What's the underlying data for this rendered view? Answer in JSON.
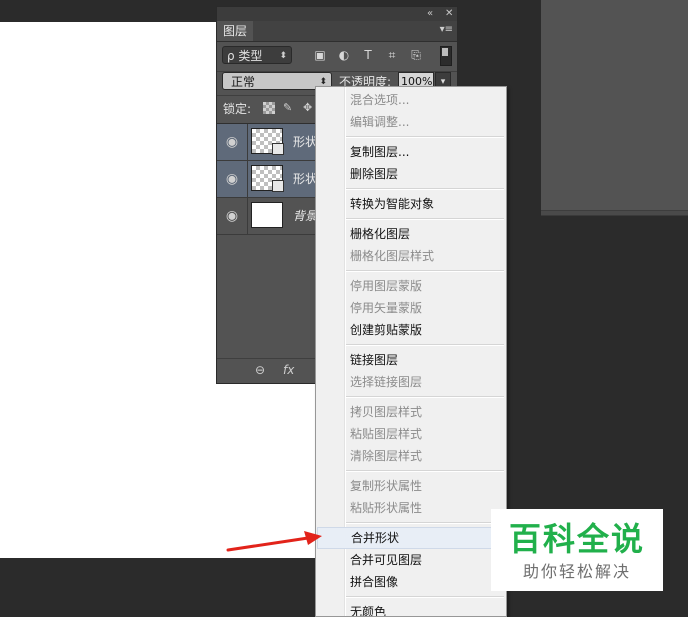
{
  "layers_panel": {
    "top_icons": {
      "collapse": "«",
      "close": "✕"
    },
    "tab_label": "图层",
    "filter": {
      "label": "ρ 类型"
    },
    "blend_mode": "正常",
    "opacity_label": "不透明度:",
    "opacity_value": "100%",
    "lock_label": "锁定:",
    "layers": [
      {
        "name": "形状",
        "thumbnail": "checker",
        "selected": true
      },
      {
        "name": "形状",
        "thumbnail": "checker",
        "selected": true
      },
      {
        "name": "背景",
        "thumbnail": "white",
        "selected": false
      }
    ],
    "footer_icons": {
      "link": "⊖",
      "fx": "fx"
    }
  },
  "context_menu": {
    "items": [
      {
        "label": "混合选项...",
        "disabled": true
      },
      {
        "label": "编辑调整...",
        "disabled": true
      },
      {
        "label": "复制图层...",
        "disabled": false
      },
      {
        "label": "删除图层",
        "disabled": false
      },
      {
        "label": "转换为智能对象",
        "disabled": false
      },
      {
        "label": "栅格化图层",
        "disabled": false
      },
      {
        "label": "栅格化图层样式",
        "disabled": true
      },
      {
        "label": "停用图层蒙版",
        "disabled": true
      },
      {
        "label": "停用矢量蒙版",
        "disabled": true
      },
      {
        "label": "创建剪贴蒙版",
        "disabled": false
      },
      {
        "label": "链接图层",
        "disabled": false
      },
      {
        "label": "选择链接图层",
        "disabled": true
      },
      {
        "label": "拷贝图层样式",
        "disabled": true
      },
      {
        "label": "粘贴图层样式",
        "disabled": true
      },
      {
        "label": "清除图层样式",
        "disabled": true
      },
      {
        "label": "复制形状属性",
        "disabled": true
      },
      {
        "label": "粘贴形状属性",
        "disabled": true
      },
      {
        "label": "合并形状",
        "disabled": false,
        "highlighted": true
      },
      {
        "label": "合并可见图层",
        "disabled": false
      },
      {
        "label": "拼合图像",
        "disabled": false
      },
      {
        "label": "无颜色",
        "disabled": false
      }
    ]
  },
  "watermark": {
    "title": "百科全说",
    "subtitle": "助你轻松解决"
  },
  "colors": {
    "panel_bg": "#535353",
    "menu_bg": "#f0f0f0",
    "selected_layer": "#5f6a7a",
    "watermark_green": "#21b04b",
    "arrow_red": "#e2231a"
  }
}
